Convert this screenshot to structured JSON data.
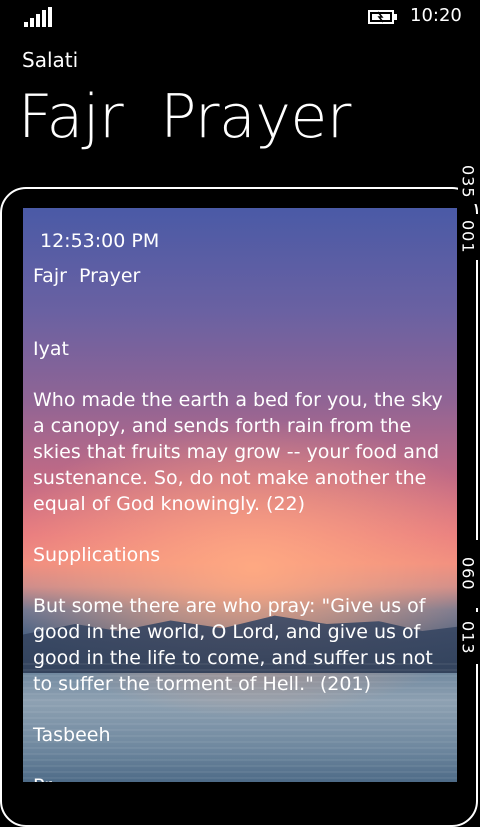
{
  "status_bar": {
    "time": "10:20",
    "signal_icon": "signal-bars-icon",
    "battery_icon": "battery-charging-icon"
  },
  "app": {
    "name": "Salati",
    "page_title": "Fajr  Prayer"
  },
  "card": {
    "clock": "12:53:00 PM",
    "title": "Fajr  Prayer",
    "sections": {
      "iyat_heading": "Iyat",
      "iyat_text": "Who made the earth a bed for you, the sky a canopy, and sends forth rain from the skies that fruits may grow -- your food and sustenance. So, do not make another the equal of God knowingly. (22)",
      "supplications_heading": "Supplications",
      "supplications_text": "But some there are who pray: \"Give us of good in the world, O Lord, and give us of good in the life to come, and suffer us not to suffer the torment of Hell.\" (201)",
      "tasbeeh_heading": "Tasbeeh",
      "cut_text": "Pr"
    }
  },
  "side_tabs": {
    "top_a": "035",
    "top_b": "001",
    "bottom_a": "060",
    "bottom_b": "013"
  }
}
